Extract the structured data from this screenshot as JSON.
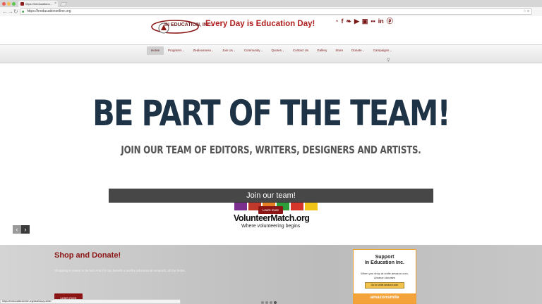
{
  "browser": {
    "tab_title": "https://ineducationo...",
    "url": "https://ineducationonline.org",
    "traffic_colors": [
      "#ee5b55",
      "#f5bd4f",
      "#5ac84e"
    ]
  },
  "header": {
    "logo_text": "IN EDUCATION, INC.",
    "tagline": "Every Day is Education Day!",
    "social_icons": [
      "rss-icon",
      "facebook-icon",
      "twitter-icon",
      "youtube-icon",
      "instagram-icon",
      "flickr-icon",
      "linkedin-icon",
      "pinterest-icon"
    ],
    "social_glyphs": [
      "◔",
      "f",
      "❧",
      "▶",
      "▣",
      "••",
      "in",
      "ⓟ"
    ]
  },
  "menu": {
    "items": [
      "Home",
      "Programs",
      "Zealousness",
      "Join Us",
      "Community",
      "Quotes",
      "Contact Us",
      "Gallery",
      "Store",
      "Donate",
      "Campaigns"
    ],
    "has_dropdown": [
      false,
      true,
      true,
      true,
      true,
      true,
      false,
      false,
      false,
      true,
      true
    ],
    "active_index": 0
  },
  "hero": {
    "title": "BE PART OF THE TEAM!",
    "subtitle": "JOIN OUR TEAM OF EDITORS, WRITERS, DESIGNERS AND ARTISTS.",
    "caption": "Join our team!",
    "button": "Learn more",
    "vm_logo": "VolunteerMatch.org",
    "vm_tag": "Where volunteering begins",
    "hand_colors": [
      "#7a2e8e",
      "#c0392b",
      "#e67e22",
      "#2e9e3a",
      "#d4362a",
      "#f0c419"
    ],
    "prev_arrow": "‹",
    "next_arrow": "›"
  },
  "shop": {
    "title": "Shop and Donate!",
    "text": "Shopping is meant to be fun! And if it can benefit a worthy educational nonprofit, all the better.",
    "button": "Learn more",
    "dot_count": 4,
    "active_dot": 3
  },
  "amazon": {
    "heading1": "Support",
    "heading2": "In Education Inc.",
    "line1": "When you shop at smile.amazon.com,",
    "line2": "Amazon donates",
    "button": "Go to smile.amazon.com",
    "brand": "amazonsmile"
  },
  "status_url": "https://ineducationonline.org/#soliloquy-slider"
}
